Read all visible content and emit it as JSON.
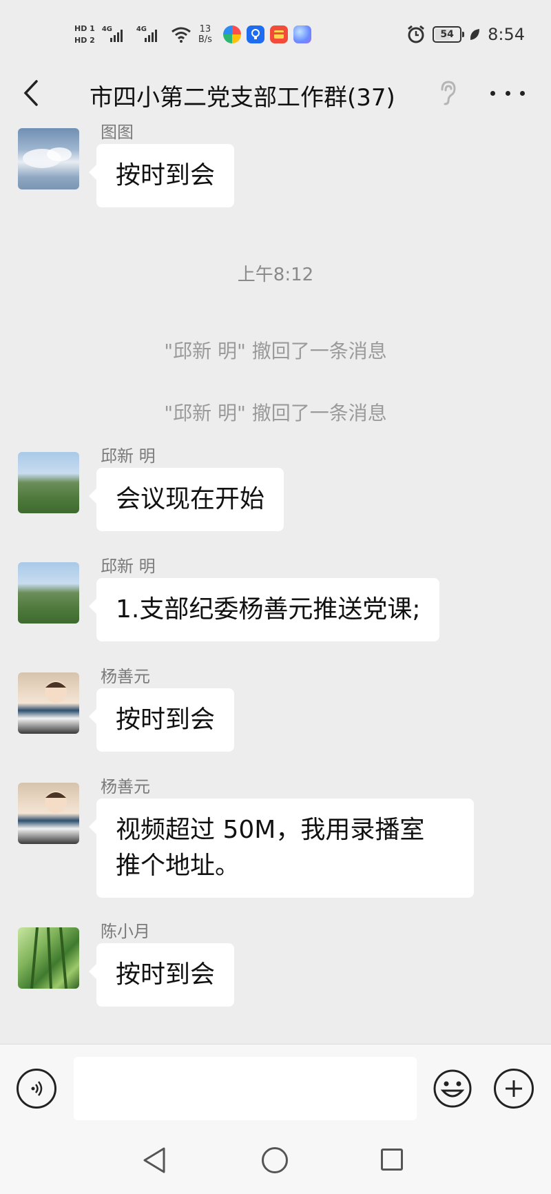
{
  "status_bar": {
    "hd1": "HD 1",
    "hd2": "HD 2",
    "net1": "4G",
    "net2": "4G",
    "speed_value": "13",
    "speed_unit": "B/s",
    "battery": "54",
    "time": "8:54"
  },
  "header": {
    "title": "市四小第二党支部工作群(37)"
  },
  "messages": [
    {
      "sender": "图图",
      "text": "按时到会"
    },
    {
      "time": "上午8:12"
    },
    {
      "system": "\"邱新 明\" 撤回了一条消息"
    },
    {
      "system": "\"邱新 明\" 撤回了一条消息"
    },
    {
      "sender": "邱新 明",
      "text": "会议现在开始"
    },
    {
      "sender": "邱新 明",
      "text": "1.支部纪委杨善元推送党课;"
    },
    {
      "sender": "杨善元",
      "text": "按时到会"
    },
    {
      "sender": "杨善元",
      "text_line1": "视频超过 50M，我用录播室",
      "text_line2": "推个地址。"
    },
    {
      "sender": "陈小月",
      "text": "按时到会"
    }
  ],
  "input": {
    "value": "",
    "placeholder": ""
  },
  "colors": {
    "background": "#ededed",
    "bubble": "#ffffff",
    "sender_text": "#7a7a7a",
    "system_text": "#9a9a9a"
  },
  "icons": [
    "back-arrow-icon",
    "ear-icon",
    "more-icon",
    "voice-icon",
    "emoji-icon",
    "plus-icon",
    "nav-back-icon",
    "nav-home-icon",
    "nav-recent-icon"
  ]
}
